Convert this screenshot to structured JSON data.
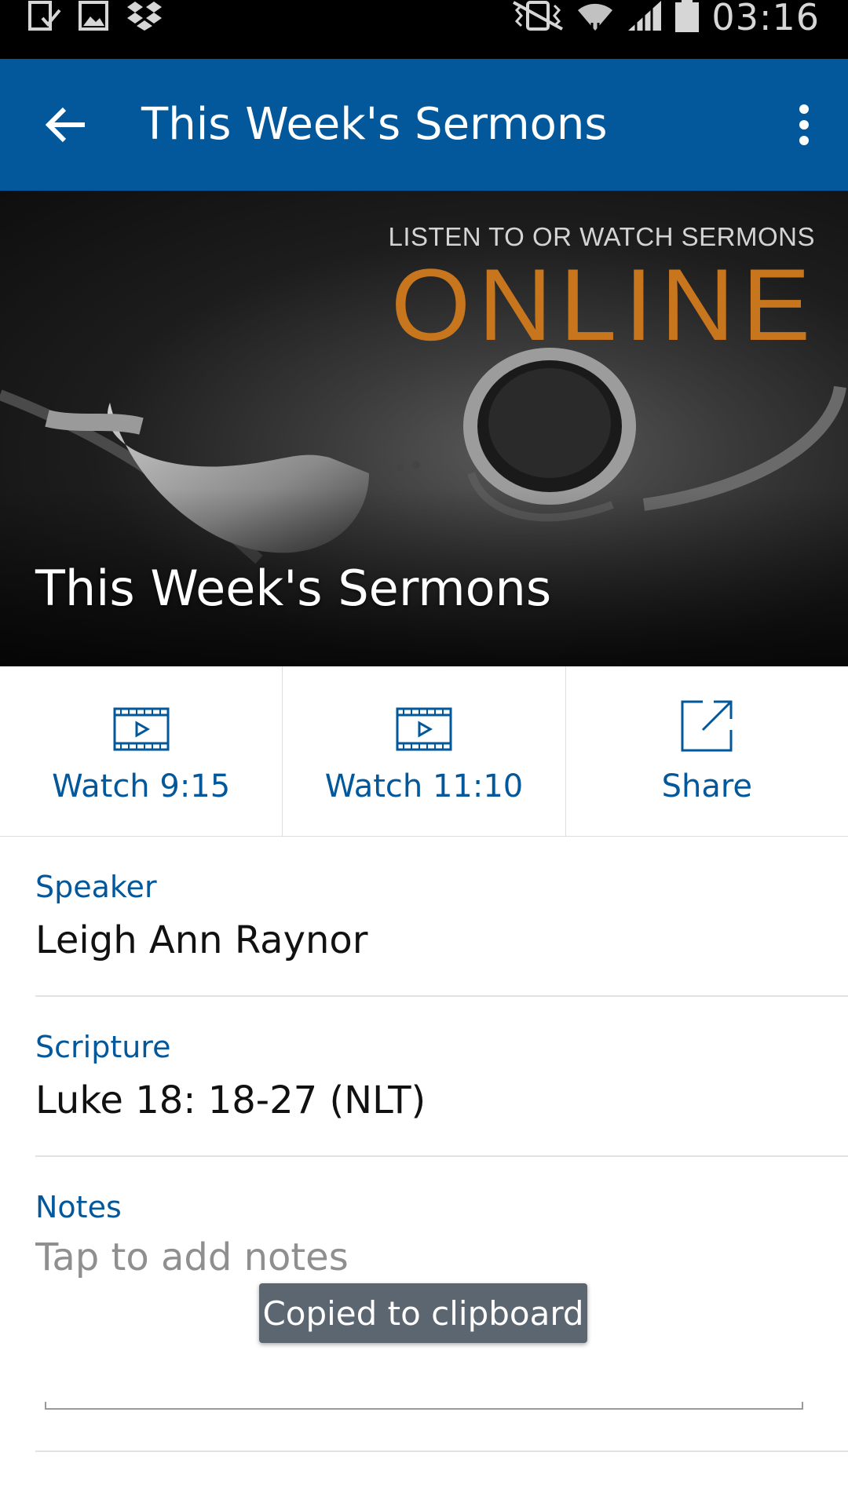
{
  "status_bar": {
    "time": "03:16",
    "left_icons": [
      "download-done-icon",
      "gallery-icon",
      "dropbox-icon"
    ],
    "right_icons": [
      "vibrate-icon",
      "wifi-icon",
      "signal-icon",
      "battery-icon"
    ]
  },
  "app_bar": {
    "title": "This Week's Sermons",
    "back_icon": "arrow-back-icon",
    "menu_icon": "more-vertical-icon",
    "background": "#02589a"
  },
  "hero": {
    "tagline": "LISTEN TO OR WATCH SERMONS",
    "headline": "ONLINE",
    "title": "This Week's Sermons",
    "headline_color": "#c8761d"
  },
  "actions": [
    {
      "label": "Watch 9:15",
      "icon": "video-play-icon"
    },
    {
      "label": "Watch 11:10",
      "icon": "video-play-icon"
    },
    {
      "label": "Share",
      "icon": "share-external-icon"
    }
  ],
  "details": {
    "speaker_label": "Speaker",
    "speaker_value": "Leigh Ann Raynor",
    "scripture_label": "Scripture",
    "scripture_value": "Luke 18: 18-27 (NLT)",
    "notes_label": "Notes",
    "notes_placeholder": "Tap to add notes",
    "notes_value": ""
  },
  "toast": {
    "message": "Copied to clipboard"
  },
  "colors": {
    "accent": "#02589a",
    "label_blue": "#02589a",
    "toast_bg": "#5c6670"
  }
}
